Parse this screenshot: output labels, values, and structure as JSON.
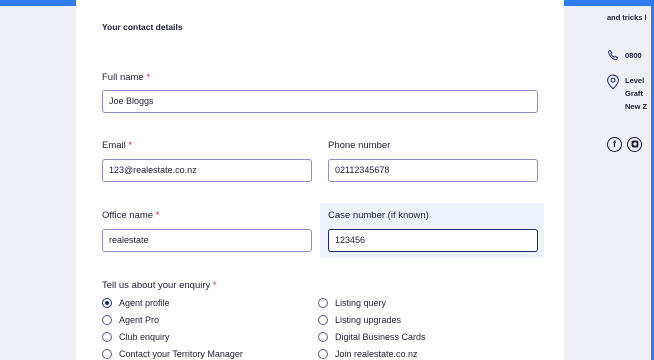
{
  "form": {
    "section_title": "Your contact details",
    "full_name": {
      "label": "Full name",
      "required": "*",
      "value": "Joe Bloggs"
    },
    "email": {
      "label": "Email",
      "required": "*",
      "value": "123@realestate.co.nz"
    },
    "phone": {
      "label": "Phone number",
      "value": "02112345678"
    },
    "office": {
      "label": "Office name",
      "required": "*",
      "value": "realestate"
    },
    "case": {
      "label": "Case number (if known)",
      "value": "123456"
    },
    "enquiry": {
      "label": "Tell us about your enquiry",
      "required": "*",
      "options": [
        {
          "label": "Agent profile",
          "checked": true
        },
        {
          "label": "Listing query",
          "checked": false
        },
        {
          "label": "Agent Pro",
          "checked": false
        },
        {
          "label": "Listing upgrades",
          "checked": false
        },
        {
          "label": "Club enquiry",
          "checked": false
        },
        {
          "label": "Digital Business Cards",
          "checked": false
        },
        {
          "label": "Contact your Territory Manager",
          "checked": false
        },
        {
          "label": "Join realestate.co.nz",
          "checked": false
        }
      ]
    }
  },
  "sidebar": {
    "tips_text": "and tricks l",
    "phone_text": "0800",
    "address_lines": [
      "Level",
      "Graft",
      "New Z"
    ]
  },
  "colors": {
    "accent": "#1d2a6e",
    "required": "#e0203a",
    "frame": "#2f7df0"
  }
}
